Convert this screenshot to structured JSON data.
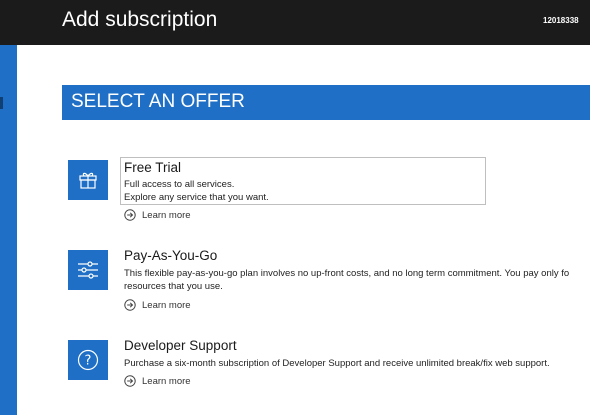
{
  "header": {
    "title": "Add subscription",
    "account": "12018338"
  },
  "section": {
    "heading": "SELECT AN OFFER"
  },
  "offers": [
    {
      "name": "Free Trial",
      "lines": [
        "Full access to all services.",
        "Explore any service that you want."
      ],
      "learn_more": "Learn more",
      "icon": "gift-icon"
    },
    {
      "name": "Pay-As-You-Go",
      "lines": [
        "This flexible pay-as-you-go plan involves no up-front costs, and no long term commitment. You pay only fo",
        "resources that you use."
      ],
      "learn_more": "Learn more",
      "icon": "sliders-icon"
    },
    {
      "name": "Developer Support",
      "lines": [
        "Purchase a six-month subscription of Developer Support and receive unlimited break/fix web support."
      ],
      "learn_more": "Learn more",
      "icon": "question-icon"
    }
  ],
  "colors": {
    "accent": "#1e6fc5",
    "topbar": "#1b1b1b"
  }
}
